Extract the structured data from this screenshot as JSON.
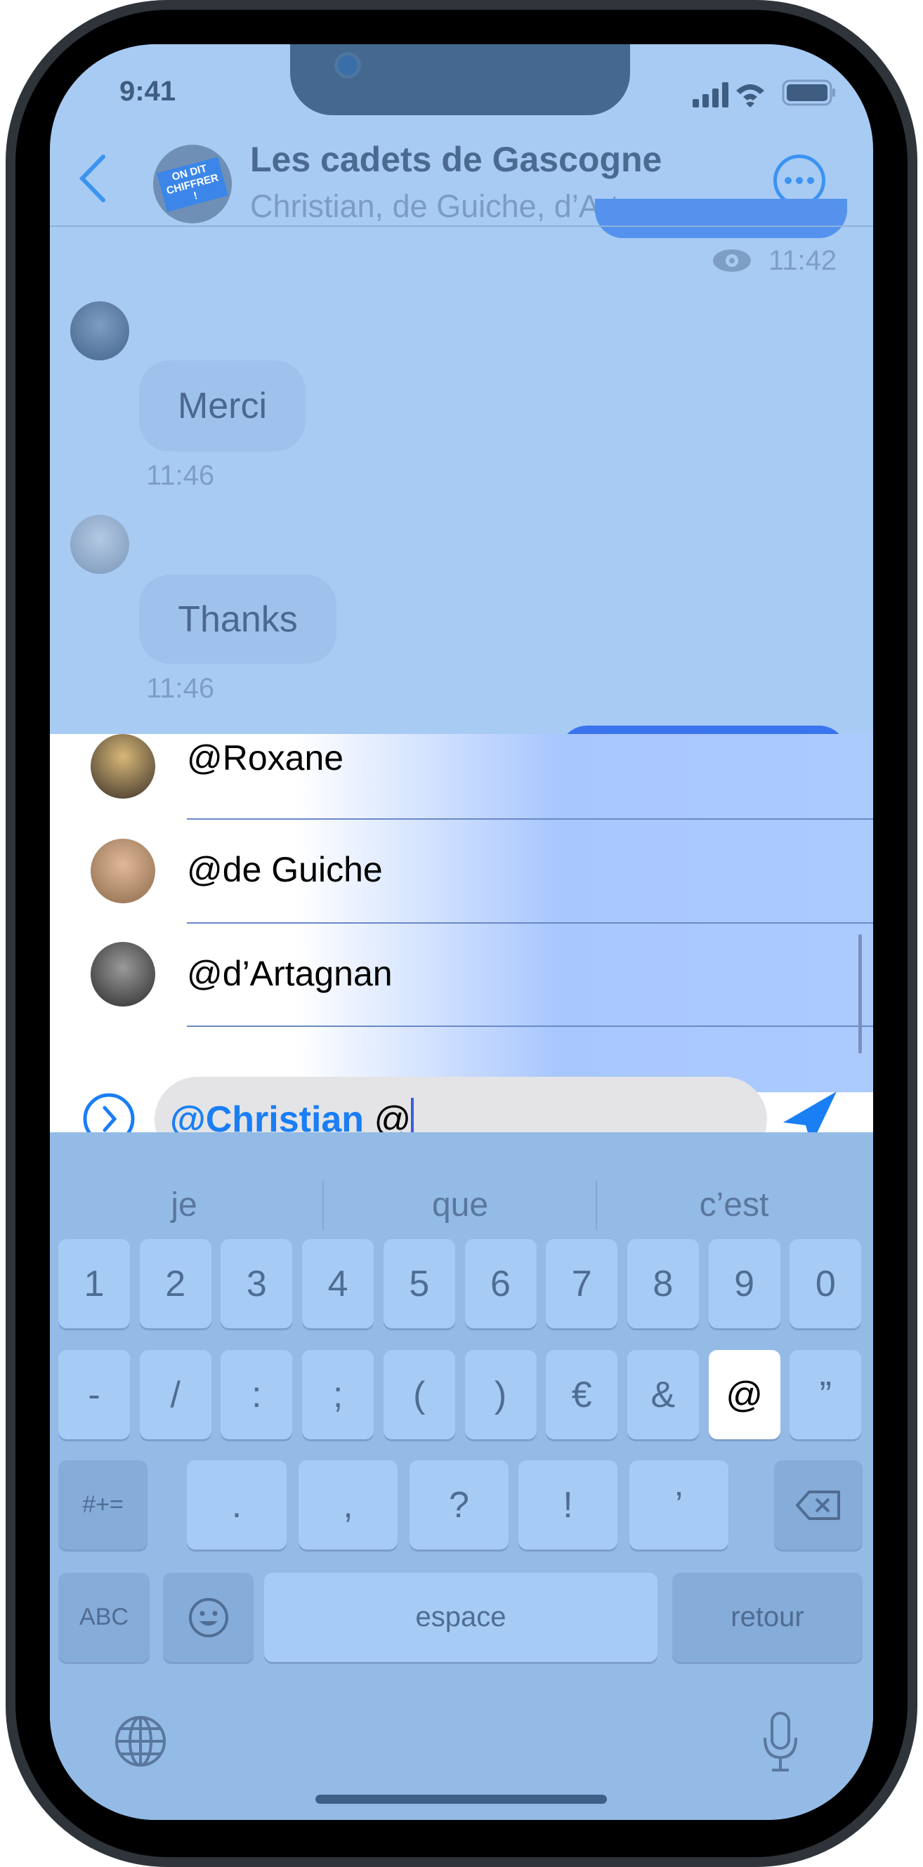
{
  "status": {
    "time": "9:41"
  },
  "header": {
    "title": "Les cadets de Gascogne",
    "subtitle": "Christian, de Guiche, d’Arta…",
    "avatar_text": "ON DIT CHIFFRER !"
  },
  "messages": [
    {
      "type": "outgoing",
      "status_icon": "eye-icon",
      "time": "11:42"
    },
    {
      "type": "incoming",
      "text": "Merci",
      "time": "11:46"
    },
    {
      "type": "incoming",
      "text": "Thanks",
      "time": "11:46"
    }
  ],
  "mentions": [
    {
      "name": "@Roxane"
    },
    {
      "name": "@de Guiche"
    },
    {
      "name": "@d’Artagnan"
    }
  ],
  "composer": {
    "mention": "@Christian",
    "typed": " @"
  },
  "suggestions": [
    "je",
    "que",
    "c’est"
  ],
  "keyboard": {
    "row1": [
      "1",
      "2",
      "3",
      "4",
      "5",
      "6",
      "7",
      "8",
      "9",
      "0"
    ],
    "row2": [
      "-",
      "/",
      ":",
      ";",
      "(",
      ")",
      "€",
      "&",
      "@",
      "”"
    ],
    "row3": {
      "symbols": "#+=",
      "keys": [
        ".",
        ",",
        "?",
        "!",
        "’"
      ]
    },
    "row4": {
      "abc": "ABC",
      "space": "espace",
      "return": "retour"
    },
    "highlighted_key": "@"
  },
  "colors": {
    "accent": "#1a7ef5",
    "screen_tint": "#a8cbf4"
  }
}
